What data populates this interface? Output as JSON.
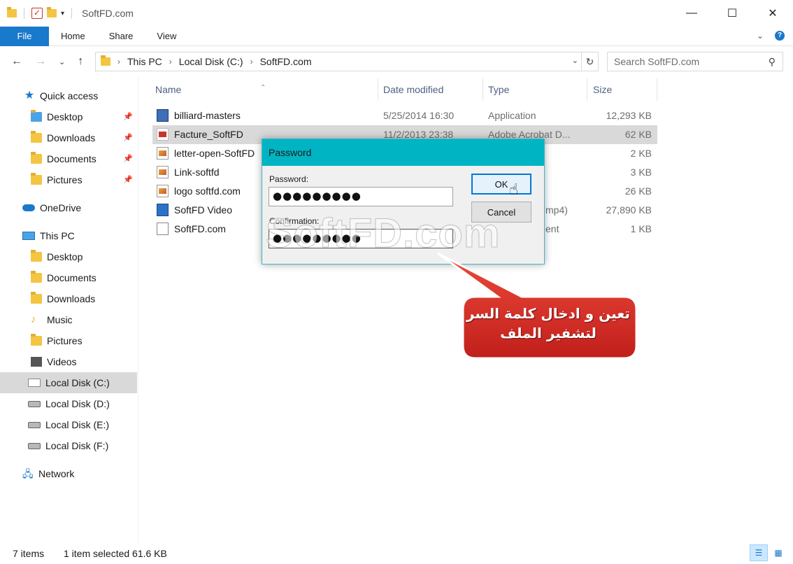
{
  "window": {
    "title": "SoftFD.com",
    "controls": [
      "—",
      "☐",
      "✕"
    ]
  },
  "ribbon": {
    "file_tab": "File",
    "tabs": [
      "Home",
      "Share",
      "View"
    ]
  },
  "address": {
    "crumbs": [
      "This PC",
      "Local Disk (C:)",
      "SoftFD.com"
    ],
    "search_placeholder": "Search SoftFD.com"
  },
  "sidebar": {
    "items": [
      {
        "label": "Quick access",
        "icon": "star-icon",
        "pinned": false
      },
      {
        "label": "Desktop",
        "icon": "desktop-folder-icon",
        "pinned": true
      },
      {
        "label": "Downloads",
        "icon": "downloads-folder-icon",
        "pinned": true
      },
      {
        "label": "Documents",
        "icon": "documents-folder-icon",
        "pinned": true
      },
      {
        "label": "Pictures",
        "icon": "pictures-folder-icon",
        "pinned": true
      },
      {
        "label": "OneDrive",
        "icon": "cloud-icon",
        "pinned": false
      },
      {
        "label": "This PC",
        "icon": "computer-icon",
        "pinned": false
      },
      {
        "label": "Desktop",
        "icon": "desktop-folder-icon",
        "pinned": false
      },
      {
        "label": "Documents",
        "icon": "documents-folder-icon",
        "pinned": false
      },
      {
        "label": "Downloads",
        "icon": "downloads-folder-icon",
        "pinned": false
      },
      {
        "label": "Music",
        "icon": "music-icon",
        "pinned": false
      },
      {
        "label": "Pictures",
        "icon": "pictures-folder-icon",
        "pinned": false
      },
      {
        "label": "Videos",
        "icon": "videos-folder-icon",
        "pinned": false
      },
      {
        "label": "Local Disk (C:)",
        "icon": "windows-drive-icon",
        "pinned": false
      },
      {
        "label": "Local Disk (D:)",
        "icon": "drive-icon",
        "pinned": false
      },
      {
        "label": "Local Disk (E:)",
        "icon": "drive-icon",
        "pinned": false
      },
      {
        "label": "Local Disk (F:)",
        "icon": "drive-icon",
        "pinned": false
      },
      {
        "label": "Network",
        "icon": "network-icon",
        "pinned": false
      }
    ]
  },
  "files": {
    "columns": [
      "Name",
      "Date modified",
      "Type",
      "Size"
    ],
    "rows": [
      {
        "name": "billiard-masters",
        "date": "5/25/2014 16:30",
        "type": "Application",
        "size": "12,293 KB",
        "icon": "application-icon"
      },
      {
        "name": "Facture_SoftFD",
        "date": "11/2/2013 23:38",
        "type": "Adobe Acrobat D...",
        "size": "62 KB",
        "icon": "pdf-icon"
      },
      {
        "name": "letter-open-SoftFD",
        "date": "",
        "type": "",
        "size": "2 KB",
        "icon": "image-icon"
      },
      {
        "name": "Link-softfd",
        "date": "",
        "type": "",
        "size": "3 KB",
        "icon": "image-icon"
      },
      {
        "name": "logo softfd.com",
        "date": "",
        "type": "",
        "size": "26 KB",
        "icon": "image-icon"
      },
      {
        "name": "SoftFD Video",
        "date": "",
        "type": "mp4)",
        "size": "27,890 KB",
        "icon": "video-icon"
      },
      {
        "name": "SoftFD.com",
        "date": "",
        "type": "ent",
        "size": "1 KB",
        "icon": "text-file-icon"
      }
    ]
  },
  "status": {
    "count": "7 items",
    "selection": "1 item selected  61.6 KB"
  },
  "dialog": {
    "title": "Password",
    "password_label": "Password:",
    "password_value": "●●●●●●●●●",
    "confirm_label": "Confirmation:",
    "confirm_value": "●●●●●●●●●",
    "ok_label": "OK",
    "cancel_label": "Cancel"
  },
  "watermark": "SoftFD.com",
  "callout": {
    "line1": "تعين و ادخال كلمة السر",
    "line2": "لتشفير الملف",
    "fill": "#d9302a"
  }
}
